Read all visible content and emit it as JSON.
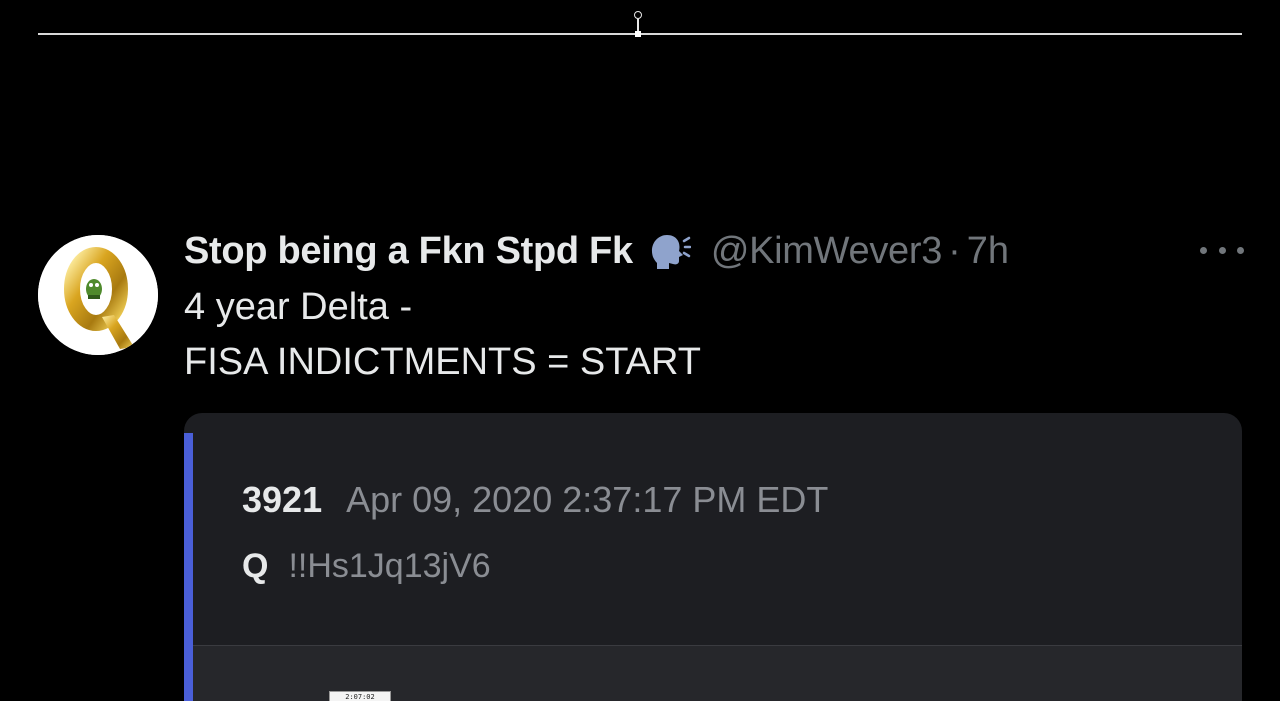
{
  "tweet": {
    "display_name": "Stop being a Fkn Stpd Fk",
    "handle": "@KimWever3",
    "separator": "·",
    "time_ago": "7h",
    "lines": [
      "4 year Delta -",
      "FISA INDICTMENTS = START"
    ],
    "icons": {
      "badge": "speaking-head-icon",
      "menu": "more-options-icon"
    }
  },
  "card": {
    "post_number": "3921",
    "date": "Apr 09, 2020 2:37:17 PM EDT",
    "author": "Q",
    "tripcode": "!!Hs1Jq13jV6",
    "embedded_timestamp": "2:07:02"
  },
  "colors": {
    "background": "#000000",
    "text_primary": "#e7e9ea",
    "text_secondary": "#71767b",
    "card_background": "#1d1e22",
    "card_accent": "#4a5fd8"
  }
}
